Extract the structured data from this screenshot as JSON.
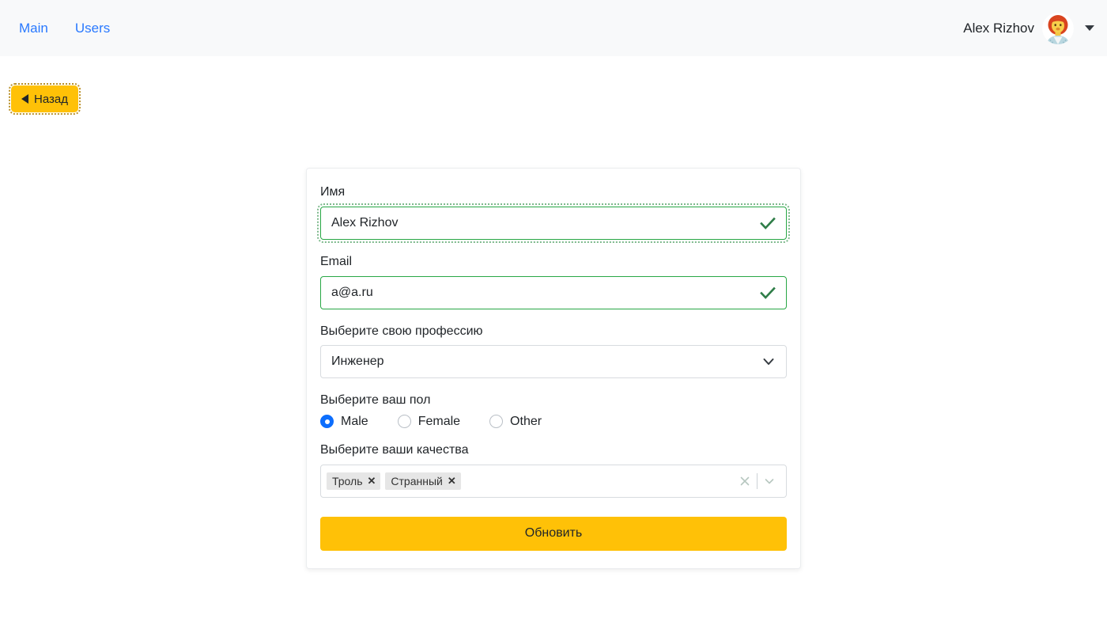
{
  "navbar": {
    "links": [
      {
        "label": "Main",
        "name": "nav-link-main"
      },
      {
        "label": "Users",
        "name": "nav-link-users"
      }
    ],
    "user_name": "Alex Rizhov",
    "avatar_icon": "person-avatar-icon",
    "caret_icon": "caret-down-icon",
    "background": "#f8f9fa",
    "link_color": "#2979ff"
  },
  "back_button": {
    "label": "Назад",
    "icon": "triangle-left-icon",
    "color": "#ffc107"
  },
  "form": {
    "name_field": {
      "label": "Имя",
      "value": "Alex Rizhov",
      "placeholder": "Имя",
      "valid": true,
      "valid_icon": "check-icon",
      "border_color": "#28a745"
    },
    "email_field": {
      "label": "Email",
      "value": "a@a.ru",
      "placeholder": "Email",
      "valid": true,
      "valid_icon": "check-icon",
      "border_color": "#28a745"
    },
    "profession": {
      "label": "Выберите свою профессию",
      "selected": "Инженер",
      "chevron_icon": "chevron-down-icon"
    },
    "gender": {
      "label": "Выберите ваш пол",
      "options": [
        {
          "label": "Male",
          "checked": true
        },
        {
          "label": "Female",
          "checked": false
        },
        {
          "label": "Other",
          "checked": false
        }
      ],
      "accent": "#0d6efd"
    },
    "qualities": {
      "label": "Выберите ваши качества",
      "tags": [
        {
          "label": "Троль",
          "remove_icon": "tag-remove-icon"
        },
        {
          "label": "Странный",
          "remove_icon": "tag-remove-icon"
        }
      ],
      "clear_icon": "clear-all-icon",
      "chevron_icon": "chevron-down-icon"
    },
    "submit": {
      "label": "Обновить",
      "color": "#ffc107"
    }
  }
}
